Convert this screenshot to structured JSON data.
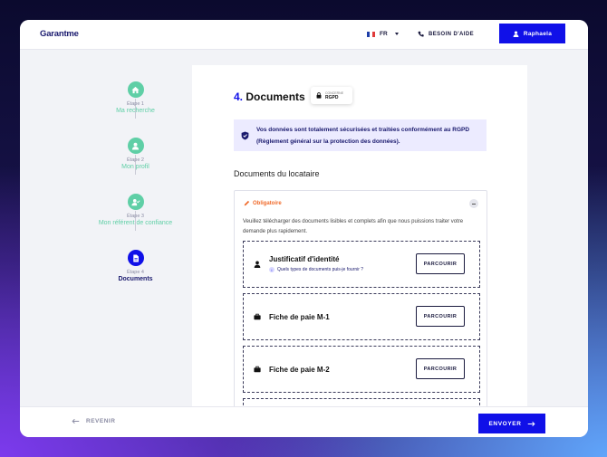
{
  "header": {
    "logo": "Garantme",
    "language": "FR",
    "help_label": "BESOIN D'AIDE",
    "user_label": "Raphaela"
  },
  "steps": [
    {
      "num": "Étape 1",
      "name": "Ma recherche",
      "icon": "home-icon",
      "state": "done"
    },
    {
      "num": "Étape 2",
      "name": "Mon profil",
      "icon": "user-icon",
      "state": "done"
    },
    {
      "num": "Étape 3",
      "name": "Mon référent de confiance",
      "icon": "user-check-icon",
      "state": "done"
    },
    {
      "num": "Étape 4",
      "name": "Documents",
      "icon": "document-icon",
      "state": "active"
    }
  ],
  "main": {
    "step_number": "4.",
    "title": "Documents",
    "concerned_small": "CONCERNE",
    "concerned_big": "RGPD",
    "notice": "Vos données sont totalement sécurisées et traitées conformément au RGPD (Règlement général sur la protection des données).",
    "section_title": "Documents du locataire",
    "required_label": "Obligatoire",
    "instructions": "Veuillez télécharger des documents lisibles et complets afin que nous puissions traiter votre demande plus rapidement.",
    "documents": [
      {
        "label": "Justificatif d'identité",
        "hint": "Quels types de documents puis-je fournir ?",
        "button": "PARCOURIR",
        "icon": "user-icon"
      },
      {
        "label": "Fiche de paie M-1",
        "hint": "",
        "button": "PARCOURIR",
        "icon": "briefcase-icon"
      },
      {
        "label": "Fiche de paie M-2",
        "hint": "",
        "button": "PARCOURIR",
        "icon": "briefcase-icon"
      }
    ]
  },
  "footer": {
    "back_label": "REVENIR",
    "send_label": "ENVOYER"
  },
  "colors": {
    "accent": "#1010e8",
    "done": "#5fcfa6",
    "warning": "#f06a2a",
    "notice_bg": "#ecebff"
  }
}
